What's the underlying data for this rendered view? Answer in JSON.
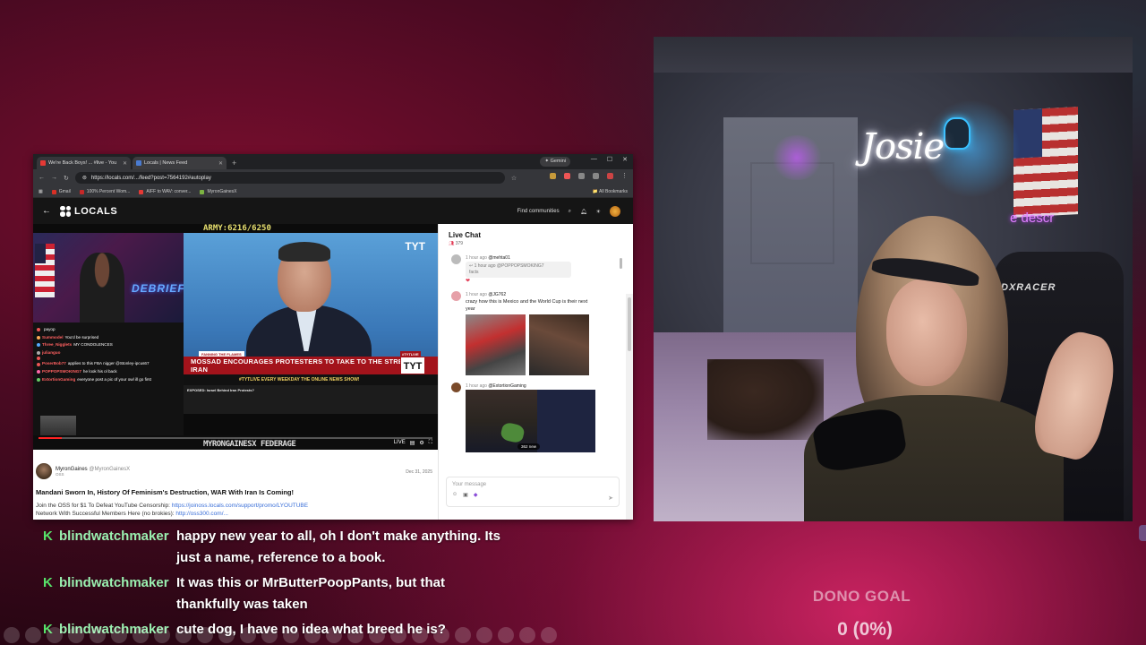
{
  "browser": {
    "tabs": [
      {
        "label": "We're Back Boys! ... #live - You",
        "active": false,
        "icon_color": "#e53935"
      },
      {
        "label": "Locals | News Feed",
        "active": true,
        "icon_color": "#4a7bd0"
      }
    ],
    "gemini_label": "Gemini",
    "url": "https://locals.com/.../feed?post=7564192#autoplay",
    "bookmarks": [
      {
        "label": "Gmail",
        "color": "#d93025"
      },
      {
        "label": "100% Percent Wom...",
        "color": "#c62828"
      },
      {
        "label": "AIFF to WAV: conver...",
        "color": "#e53935"
      },
      {
        "label": "MyronGainesX",
        "color": "#7cb342"
      }
    ],
    "all_bookmarks": "All Bookmarks"
  },
  "site": {
    "logo": "LOCALS",
    "find_communities": "Find communities"
  },
  "video": {
    "army_text": "ARMY:6216/6250",
    "debrief": "DEBRIEF",
    "tyt_logo": "TYT",
    "lower_third_tag_left": "FANNING THE FLAMES",
    "lower_third_tag_right": "#TYTLIVE",
    "headline": "MOSSAD ENCOURAGES PROTESTERS TO TAKE TO THE STREETS IN IRAN",
    "tyt_box": "TYT",
    "ticker": "#TYTLIVE EVERY WEEKDAY THE ONLINE NEWS SHOW!",
    "yt_title": "EXPOSED: Israel Behind Iran Protests?",
    "scroll_name": "MYRONGAINESX FEDERAGE",
    "progress": 0.06,
    "stream_chat": [
      {
        "name": "",
        "text": "payop",
        "color": "#e55"
      },
      {
        "name": "Summodel",
        "text": "You'd be surprised",
        "color": "#fa5"
      },
      {
        "name": "Three_Nigglets",
        "text": "MY CONDOLENCES",
        "color": "#5af"
      },
      {
        "name": "julianguo",
        "text": "",
        "color": "#aaa"
      },
      {
        "name": "",
        "text": "",
        "color": "#e55"
      },
      {
        "name": "PoserBob77",
        "text": "applies to this FBA nigger @Stonley-ipcus67",
        "color": "#e55"
      },
      {
        "name": "POPPOPSMOKING7",
        "text": "he look his ol back",
        "color": "#f6a"
      },
      {
        "name": "ExtortionGaming",
        "text": "everyone post a pic of your owl ill go first",
        "color": "#6c6"
      }
    ]
  },
  "post": {
    "author": "MyronGaines",
    "handle": "@MyronGainesX",
    "sub": "OSS",
    "date": "Dec 31, 2025",
    "title": "Mandani Sworn In, History Of Feminism's Destruction, WAR With Iran Is Coming!",
    "line1_prefix": "Join the OSS for $1 To Defeat YouTube Censorship: ",
    "line1_link": "https://joinoss.locals.com/support/promo/LYOUTUBE",
    "line2_prefix": "Network With Successful Members Here (no brokies): ",
    "line2_link": "http://oss300.com/..."
  },
  "live_chat": {
    "title": "Live Chat",
    "count": "379",
    "messages": [
      {
        "time": "1 hour ago",
        "user": "@mehta01",
        "reply_time": "1 hour ago",
        "reply_user": "@POPPOPSMOKING7",
        "reply_text": "facts",
        "avatar_color": "#bbb"
      },
      {
        "time": "1 hour ago",
        "user": "@JG762",
        "text": "crazy how this is Mexico and the World Cup is their next year",
        "avatar_color": "#e6a0a8"
      },
      {
        "time": "1 hour ago",
        "user": "@ExtortionGaming",
        "badge": "362 new",
        "avatar_color": "#7a4a2a"
      }
    ],
    "placeholder": "Your message"
  },
  "overlay_chat": [
    {
      "user": "blindwatchmaker",
      "line1": "happy new year to all, oh I don't make anything. Its",
      "line2": "just a name, reference to a book."
    },
    {
      "user": "blindwatchmaker",
      "line1": "It was this or MrButterPoopPants, but that",
      "line2": "thankfully was taken"
    },
    {
      "user": "blindwatchmaker",
      "line1": "cute dog, I have no idea what breed he is?",
      "line2": ""
    }
  ],
  "webcam": {
    "neon_sign": "Josie",
    "neon_descr": "e descr",
    "chair_brand": "DXRACER"
  },
  "dono_goal": {
    "label": "DONO GOAL",
    "value": "0 (0%)"
  }
}
